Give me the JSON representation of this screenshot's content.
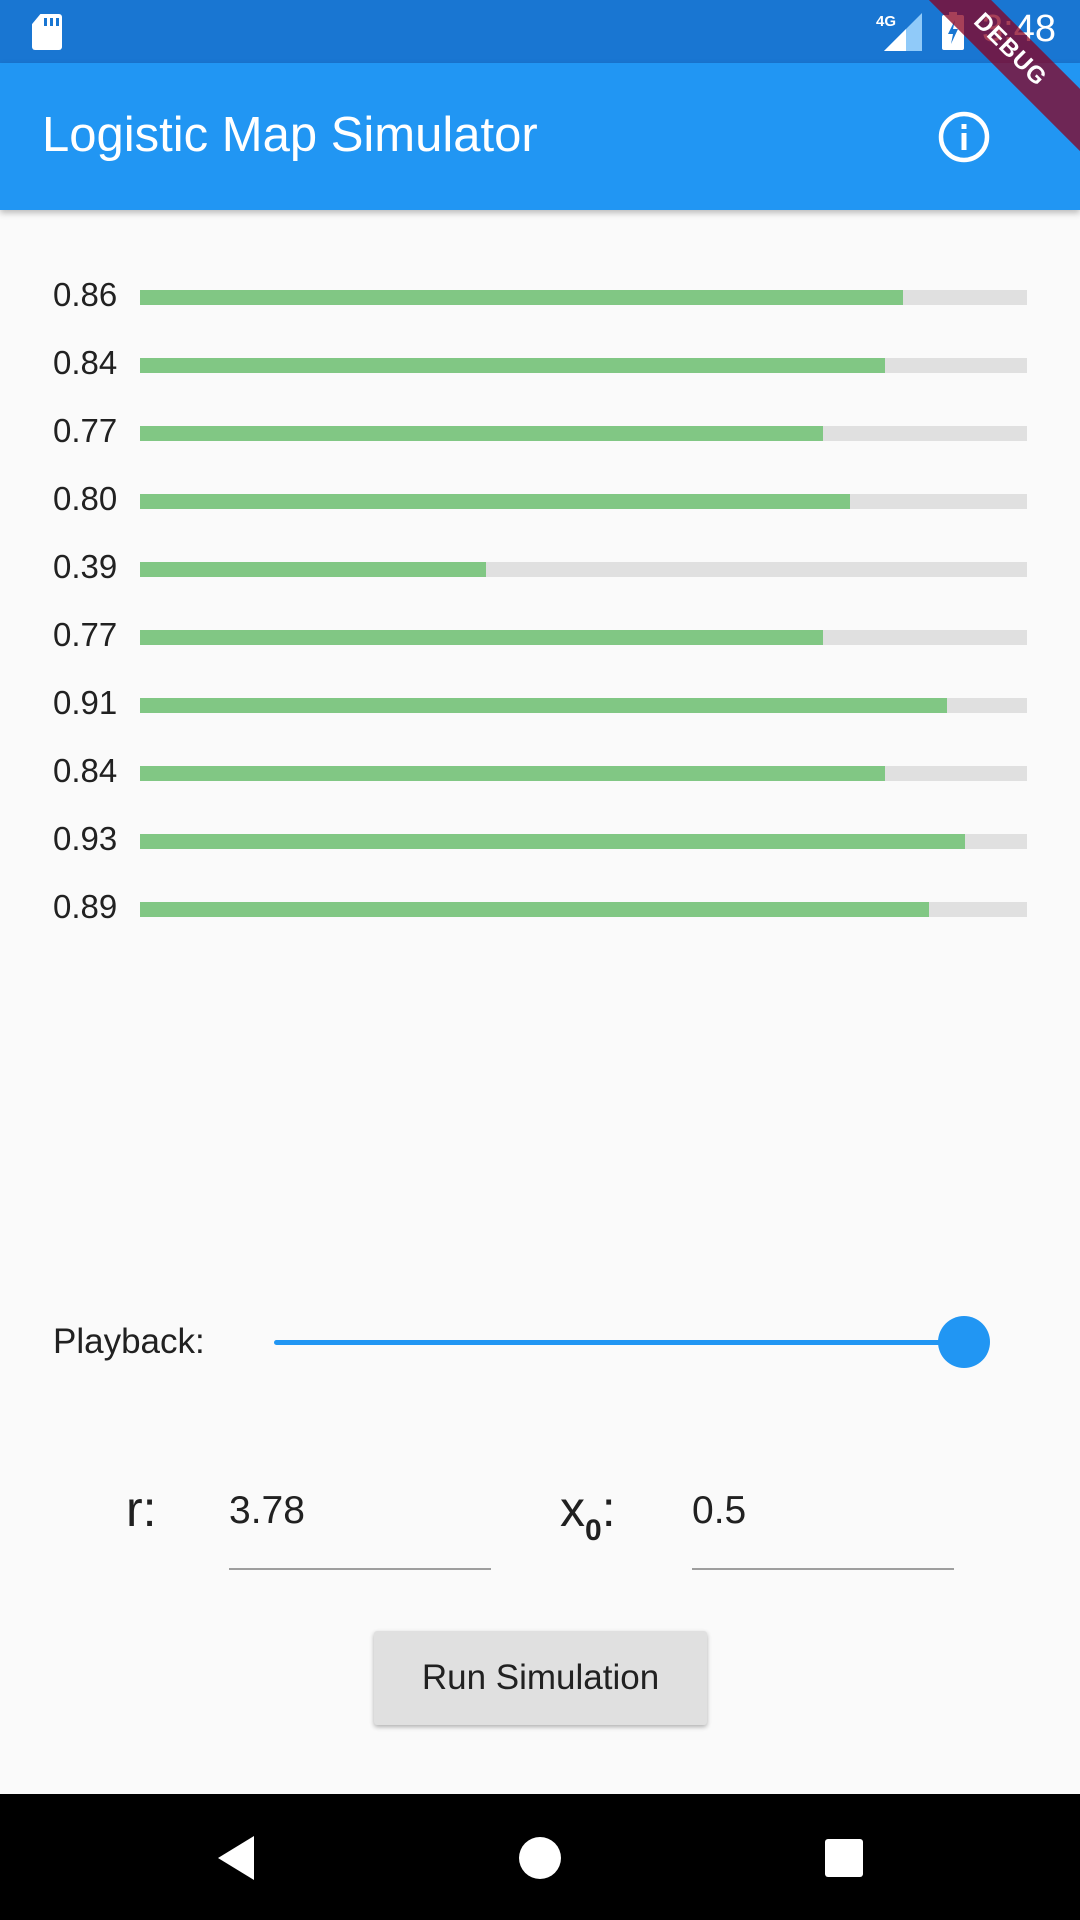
{
  "status_bar": {
    "network": "4G",
    "time": "3:48",
    "icons": [
      "sd-card-icon",
      "signal-icon",
      "battery-charging-icon"
    ]
  },
  "app_bar": {
    "title": "Logistic Map Simulator",
    "action_icon": "info-icon"
  },
  "debug_banner": "DEBUG",
  "colors": {
    "primary": "#2196f3",
    "primary_dark": "#1976d2",
    "bar_fill": "#81c784",
    "bar_track": "#e0e0e0"
  },
  "iterations": [
    {
      "label": "0.86",
      "value": 0.86
    },
    {
      "label": "0.84",
      "value": 0.84
    },
    {
      "label": "0.77",
      "value": 0.77
    },
    {
      "label": "0.80",
      "value": 0.8
    },
    {
      "label": "0.39",
      "value": 0.39
    },
    {
      "label": "0.77",
      "value": 0.77
    },
    {
      "label": "0.91",
      "value": 0.91
    },
    {
      "label": "0.84",
      "value": 0.84
    },
    {
      "label": "0.93",
      "value": 0.93
    },
    {
      "label": "0.89",
      "value": 0.89
    }
  ],
  "playback": {
    "label": "Playback:",
    "value": 1.0
  },
  "params": {
    "r_label": "r:",
    "r_value": "3.78",
    "x_label": "x",
    "x_subscript": "0",
    "x_colon": ":",
    "x_value": "0.5"
  },
  "run_button": {
    "label": "Run Simulation"
  },
  "nav": {
    "icons": [
      "back-icon",
      "home-icon",
      "recents-icon"
    ]
  }
}
